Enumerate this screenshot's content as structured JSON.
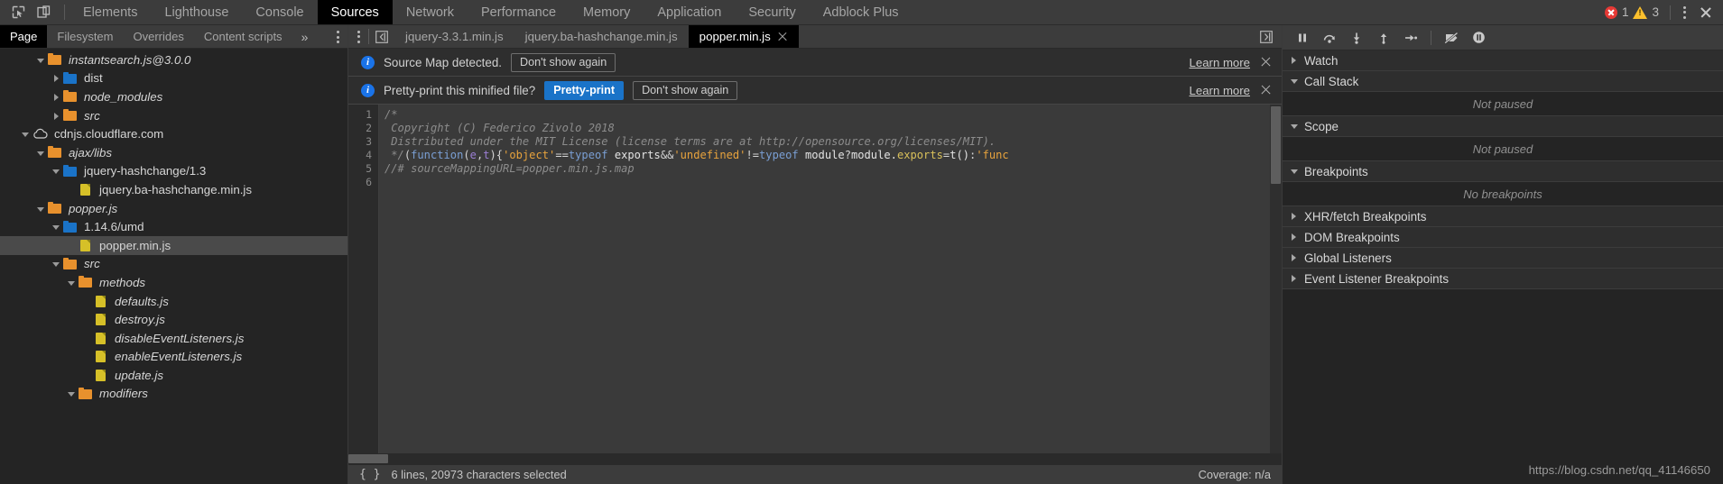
{
  "toolbar": {
    "inspect_icon": "inspect-element-icon",
    "device_icon": "device-toolbar-icon",
    "panels": [
      {
        "label": "Elements",
        "active": false
      },
      {
        "label": "Lighthouse",
        "active": false
      },
      {
        "label": "Console",
        "active": false
      },
      {
        "label": "Sources",
        "active": true
      },
      {
        "label": "Network",
        "active": false
      },
      {
        "label": "Performance",
        "active": false
      },
      {
        "label": "Memory",
        "active": false
      },
      {
        "label": "Application",
        "active": false
      },
      {
        "label": "Security",
        "active": false
      },
      {
        "label": "Adblock Plus",
        "active": false
      }
    ],
    "error_count": "1",
    "warning_count": "3",
    "menu_icon": "more-options-icon",
    "close_icon": "close-devtools-icon"
  },
  "navigator": {
    "tabs": [
      {
        "label": "Page",
        "active": true
      },
      {
        "label": "Filesystem",
        "active": false
      },
      {
        "label": "Overrides",
        "active": false
      },
      {
        "label": "Content scripts",
        "active": false
      }
    ],
    "more_label": "»",
    "menu_icon": "navigator-more-options-icon",
    "tree": [
      {
        "label": "instantsearch.js@3.0.0",
        "indent": 2,
        "type": "folder",
        "state": "open",
        "italic": true,
        "selected": false
      },
      {
        "label": "dist",
        "indent": 3,
        "type": "folder-blue",
        "state": "closed",
        "italic": false,
        "selected": false
      },
      {
        "label": "node_modules",
        "indent": 3,
        "type": "folder",
        "state": "closed",
        "italic": true,
        "selected": false
      },
      {
        "label": "src",
        "indent": 3,
        "type": "folder",
        "state": "closed",
        "italic": true,
        "selected": false
      },
      {
        "label": "cdnjs.cloudflare.com",
        "indent": 1,
        "type": "cloud",
        "state": "open",
        "italic": false,
        "selected": false
      },
      {
        "label": "ajax/libs",
        "indent": 2,
        "type": "folder",
        "state": "open",
        "italic": true,
        "selected": false
      },
      {
        "label": "jquery-hashchange/1.3",
        "indent": 3,
        "type": "folder-blue",
        "state": "open",
        "italic": false,
        "selected": false
      },
      {
        "label": "jquery.ba-hashchange.min.js",
        "indent": 4,
        "type": "file",
        "state": "none",
        "italic": false,
        "selected": false
      },
      {
        "label": "popper.js",
        "indent": 2,
        "type": "folder",
        "state": "open",
        "italic": true,
        "selected": false
      },
      {
        "label": "1.14.6/umd",
        "indent": 3,
        "type": "folder-blue",
        "state": "open",
        "italic": false,
        "selected": false
      },
      {
        "label": "popper.min.js",
        "indent": 4,
        "type": "file",
        "state": "none",
        "italic": false,
        "selected": true
      },
      {
        "label": "src",
        "indent": 3,
        "type": "folder",
        "state": "open",
        "italic": true,
        "selected": false
      },
      {
        "label": "methods",
        "indent": 4,
        "type": "folder",
        "state": "open",
        "italic": true,
        "selected": false
      },
      {
        "label": "defaults.js",
        "indent": 5,
        "type": "file",
        "state": "none",
        "italic": true,
        "selected": false
      },
      {
        "label": "destroy.js",
        "indent": 5,
        "type": "file",
        "state": "none",
        "italic": true,
        "selected": false
      },
      {
        "label": "disableEventListeners.js",
        "indent": 5,
        "type": "file",
        "state": "none",
        "italic": true,
        "selected": false
      },
      {
        "label": "enableEventListeners.js",
        "indent": 5,
        "type": "file",
        "state": "none",
        "italic": true,
        "selected": false
      },
      {
        "label": "update.js",
        "indent": 5,
        "type": "file",
        "state": "none",
        "italic": true,
        "selected": false
      },
      {
        "label": "modifiers",
        "indent": 4,
        "type": "folder",
        "state": "open",
        "italic": true,
        "selected": false
      }
    ]
  },
  "editor": {
    "menu_icon": "editor-more-options-icon",
    "back_icon": "show-navigator-icon",
    "dock_icon": "show-debugger-sidebar-icon",
    "tabs": [
      {
        "label": "jquery-3.3.1.min.js",
        "active": false,
        "closable": false
      },
      {
        "label": "jquery.ba-hashchange.min.js",
        "active": false,
        "closable": false
      },
      {
        "label": "popper.min.js",
        "active": true,
        "closable": true
      }
    ],
    "infobars": [
      {
        "icon": "info-icon",
        "text": "Source Map detected.",
        "buttons": [
          {
            "label": "Don't show again",
            "primary": false
          }
        ],
        "link": "Learn more",
        "close_icon": "dismiss-infobar-icon"
      },
      {
        "icon": "info-icon",
        "text": "Pretty-print this minified file?",
        "buttons": [
          {
            "label": "Pretty-print",
            "primary": true
          },
          {
            "label": "Don't show again",
            "primary": false
          }
        ],
        "link": "Learn more",
        "close_icon": "dismiss-infobar-icon"
      }
    ],
    "line_numbers": [
      "1",
      "2",
      "3",
      "4",
      "5",
      "6"
    ],
    "code_lines": [
      [
        {
          "t": "/*",
          "c": "cmt"
        }
      ],
      [
        {
          "t": " Copyright (C) Federico Zivolo 2018",
          "c": "cmt"
        }
      ],
      [
        {
          "t": " Distributed under the MIT License (license terms are at http://opensource.org/licenses/MIT).",
          "c": "cmt"
        }
      ],
      [
        {
          "t": " */",
          "c": "cmt"
        },
        {
          "t": "(",
          "c": "pun"
        },
        {
          "t": "function",
          "c": "kw"
        },
        {
          "t": "(",
          "c": "pun"
        },
        {
          "t": "e",
          "c": "var"
        },
        {
          "t": ",",
          "c": "pun"
        },
        {
          "t": "t",
          "c": "var"
        },
        {
          "t": "){",
          "c": "pun"
        },
        {
          "t": "'object'",
          "c": "str"
        },
        {
          "t": "==",
          "c": "pun"
        },
        {
          "t": "typeof",
          "c": "kw"
        },
        {
          "t": " exports",
          "c": "plain"
        },
        {
          "t": "&&",
          "c": "pun"
        },
        {
          "t": "'undefined'",
          "c": "str"
        },
        {
          "t": "!=",
          "c": "pun"
        },
        {
          "t": "typeof",
          "c": "kw"
        },
        {
          "t": " module",
          "c": "plain"
        },
        {
          "t": "?",
          "c": "pun"
        },
        {
          "t": "module.",
          "c": "plain"
        },
        {
          "t": "exports",
          "c": "prop"
        },
        {
          "t": "=",
          "c": "pun"
        },
        {
          "t": "t()",
          "c": "plain"
        },
        {
          "t": ":",
          "c": "pun"
        },
        {
          "t": "'func",
          "c": "str"
        }
      ],
      [
        {
          "t": "//# sourceMappingURL=popper.min.js.map",
          "c": "cmt"
        }
      ],
      [
        {
          "t": "",
          "c": "plain"
        }
      ]
    ],
    "status": {
      "format_icon": "pretty-print-braces-icon",
      "selection_info": "6 lines, 20973 characters selected",
      "coverage": "Coverage: n/a"
    }
  },
  "debugger": {
    "controls": [
      {
        "name": "resume-script-execution-icon",
        "title": "pause"
      },
      {
        "name": "step-over-next-function-call-icon",
        "title": "step-over"
      },
      {
        "name": "step-into-next-function-call-icon",
        "title": "step-into"
      },
      {
        "name": "step-out-of-current-function-icon",
        "title": "step-out"
      },
      {
        "name": "step-icon",
        "title": "step"
      },
      {
        "name": "deactivate-breakpoints-icon",
        "title": "deactivate-breakpoints"
      },
      {
        "name": "pause-on-exceptions-icon",
        "title": "pause-on-exceptions"
      }
    ],
    "sections": [
      {
        "label": "Watch",
        "state": "closed",
        "body": null
      },
      {
        "label": "Call Stack",
        "state": "open",
        "body": "Not paused"
      },
      {
        "label": "Scope",
        "state": "open",
        "body": "Not paused"
      },
      {
        "label": "Breakpoints",
        "state": "open",
        "body": "No breakpoints"
      },
      {
        "label": "XHR/fetch Breakpoints",
        "state": "closed",
        "body": null
      },
      {
        "label": "DOM Breakpoints",
        "state": "closed",
        "body": null
      },
      {
        "label": "Global Listeners",
        "state": "closed",
        "body": null
      },
      {
        "label": "Event Listener Breakpoints",
        "state": "closed",
        "body": null
      }
    ],
    "watermark": "https://blog.csdn.net/qq_41146650"
  },
  "colors": {
    "accent_blue": "#1a73c8",
    "error_red": "#e53935",
    "warning_yellow": "#fbc02d",
    "folder_orange": "#e8912d",
    "folder_blue": "#1a73c8",
    "file_yellow": "#d6c028"
  }
}
